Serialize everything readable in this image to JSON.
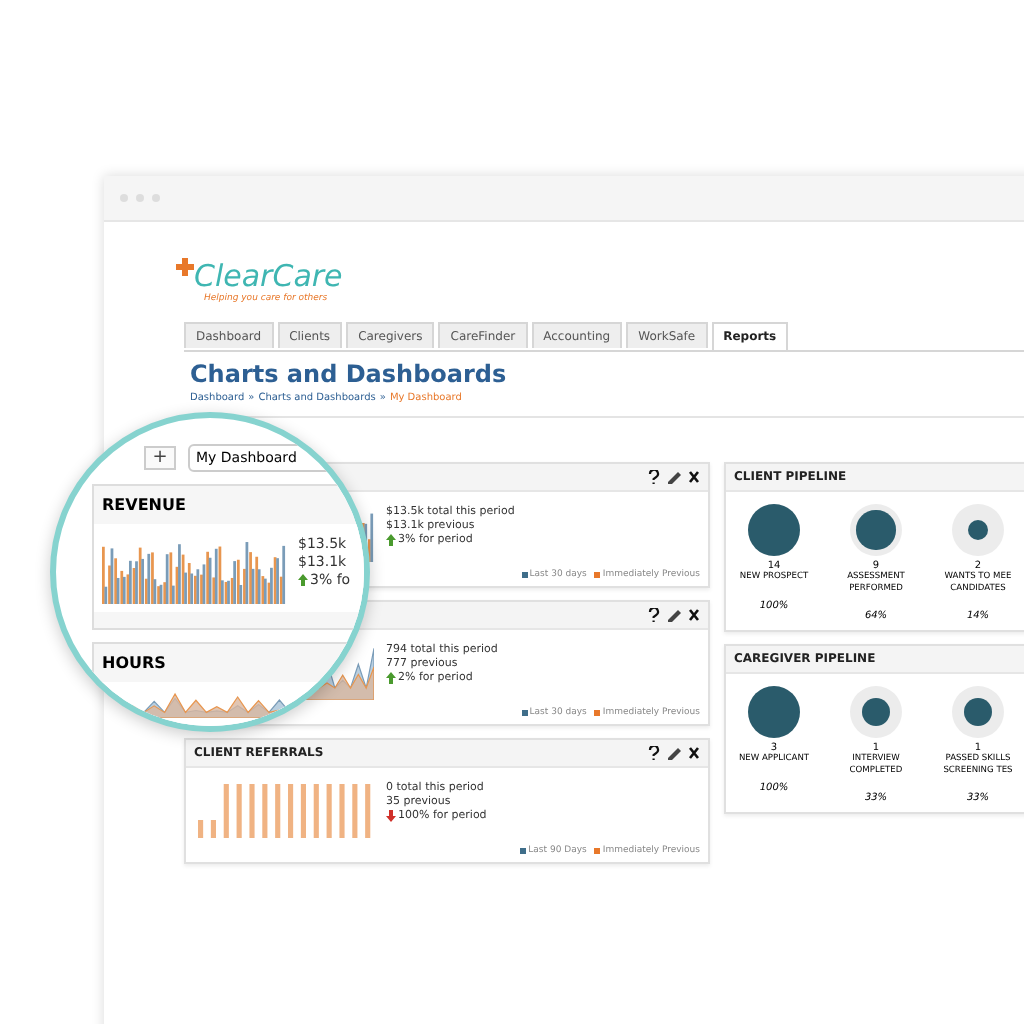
{
  "logo": {
    "name": "ClearCare",
    "tagline": "Helping you care for others"
  },
  "tabs": [
    {
      "label": "Dashboard",
      "selected": false
    },
    {
      "label": "Clients",
      "selected": false
    },
    {
      "label": "Caregivers",
      "selected": false
    },
    {
      "label": "CareFinder",
      "selected": false
    },
    {
      "label": "Accounting",
      "selected": false
    },
    {
      "label": "WorkSafe",
      "selected": false
    },
    {
      "label": "Reports",
      "selected": true
    }
  ],
  "page": {
    "title": "Charts and Dashboards",
    "separator": "»",
    "breadcrumb": [
      {
        "label": "Dashboard",
        "current": false
      },
      {
        "label": "Charts and Dashboards",
        "current": false
      },
      {
        "label": "My Dashboard",
        "current": true
      }
    ]
  },
  "widgets": [
    {
      "kind": "bars",
      "stats": [
        "$13.5k total this period",
        "$13.1k previous"
      ],
      "change": "3% for period",
      "rising": true,
      "legend": [
        {
          "label": "Last 30 days",
          "color": "#3f6e8a"
        },
        {
          "label": "Immediately Previous",
          "color": "#e8782a"
        }
      ]
    },
    {
      "kind": "area",
      "stats": [
        "794 total this period",
        "777 previous"
      ],
      "change": "2% for period",
      "rising": true,
      "legend": [
        {
          "label": "Last 30 days",
          "color": "#3f6e8a"
        },
        {
          "label": "Immediately Previous",
          "color": "#e8782a"
        }
      ]
    },
    {
      "title": "CLIENT REFERRALS",
      "kind": "spikes",
      "stats": [
        "0 total this period",
        "35 previous"
      ],
      "change": "100% for period",
      "rising": false,
      "legend": [
        {
          "label": "Last 90 Days",
          "color": "#3f6e8a"
        },
        {
          "label": "Immediately Previous",
          "color": "#e8782a"
        }
      ]
    }
  ],
  "pipelines": [
    {
      "title": "CLIENT PIPELINE",
      "stages": [
        {
          "count": "14",
          "label": [
            "NEW PROSPECT"
          ],
          "percent": "100%"
        },
        {
          "count": "9",
          "label": [
            "ASSESSMENT",
            "PERFORMED"
          ],
          "percent": "64%"
        },
        {
          "count": "2",
          "label": [
            "WANTS TO MEE",
            "CANDIDATES"
          ],
          "percent": "14%"
        }
      ]
    },
    {
      "title": "CAREGIVER PIPELINE",
      "stages": [
        {
          "count": "3",
          "label": [
            "NEW APPLICANT"
          ],
          "percent": "100%"
        },
        {
          "count": "1",
          "label": [
            "INTERVIEW",
            "COMPLETED"
          ],
          "percent": "33%"
        },
        {
          "count": "1",
          "label": [
            "PASSED SKILLS",
            "SCREENING TES"
          ],
          "percent": "33%"
        }
      ]
    }
  ],
  "magnifier": {
    "add": "+",
    "select": "My Dashboard",
    "widgets": [
      {
        "title": "REVENUE",
        "kind": "bars",
        "stats": [
          "$13.5k",
          "$13.1k"
        ],
        "change": "3% fo",
        "rising": true
      },
      {
        "title": "HOURS",
        "kind": "area"
      }
    ]
  }
}
